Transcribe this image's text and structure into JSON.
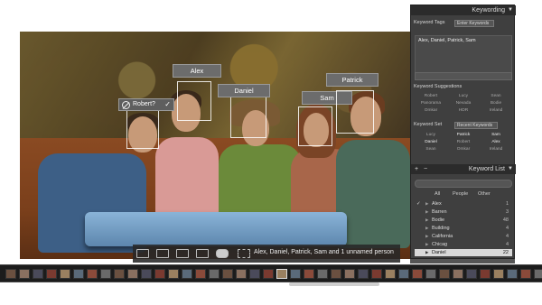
{
  "photo": {
    "face_tags": [
      {
        "name": "Alex"
      },
      {
        "name": "Daniel"
      },
      {
        "name": "Patrick"
      },
      {
        "name": "Sam"
      }
    ],
    "unnamed_tag": {
      "label": "Robert?",
      "confirm_glyph": "✓"
    },
    "toolbar": {
      "summary": "Alex, Daniel, Patrick, Sam and 1 unnamed person"
    }
  },
  "panel": {
    "header": "Keywording",
    "keyword_tags_label": "Keyword Tags",
    "keyword_tags_mode": "Enter Keywords",
    "keyword_field_value": "Alex, Daniel, Patrick, Sam",
    "suggestions_label": "Keyword Suggestions",
    "suggestions": [
      "Robert",
      "Lucy",
      "Sean",
      "Panorama",
      "Nevada",
      "Bodie",
      "Omkar",
      "HDR",
      "Ireland"
    ],
    "keyword_set_label": "Keyword Set",
    "keyword_set_mode": "Recent Keywords",
    "keyword_set": [
      {
        "label": "Lucy",
        "active": false
      },
      {
        "label": "Patrick",
        "active": true
      },
      {
        "label": "Sam",
        "active": true
      },
      {
        "label": "Daniel",
        "active": true
      },
      {
        "label": "Robert",
        "active": false
      },
      {
        "label": "Alex",
        "active": true
      },
      {
        "label": "Sean",
        "active": false
      },
      {
        "label": "Omkar",
        "active": false
      },
      {
        "label": "Ireland",
        "active": false
      }
    ],
    "keyword_list_label": "Keyword List",
    "filter_tabs": [
      "All",
      "People",
      "Other"
    ],
    "keyword_list": [
      {
        "name": "Alex",
        "count": "1",
        "checked": true,
        "selected": false
      },
      {
        "name": "Barren",
        "count": "3",
        "checked": false,
        "selected": false
      },
      {
        "name": "Bodie",
        "count": "48",
        "checked": false,
        "selected": false
      },
      {
        "name": "Building",
        "count": "4",
        "checked": false,
        "selected": false
      },
      {
        "name": "California",
        "count": "4",
        "checked": false,
        "selected": false
      },
      {
        "name": "Chicag",
        "count": "4",
        "checked": false,
        "selected": false
      },
      {
        "name": "Daniel",
        "count": "22",
        "checked": true,
        "selected": true
      }
    ],
    "header_icons": [
      "plus-icon",
      "minus-icon"
    ]
  }
}
